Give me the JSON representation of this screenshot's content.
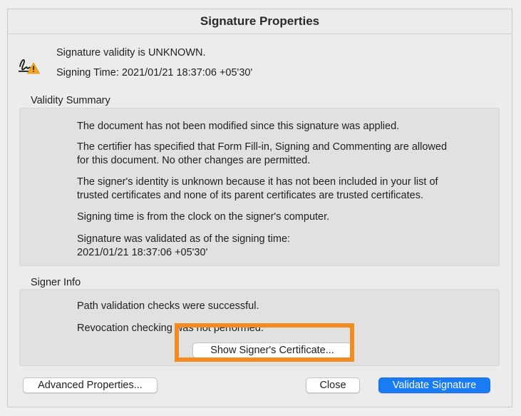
{
  "dialog": {
    "title": "Signature Properties"
  },
  "status": {
    "icon": "signature-warning-icon",
    "validity_text": "Signature validity is UNKNOWN.",
    "signing_time_text": "Signing Time:  2021/01/21 18:37:06 +05'30'"
  },
  "validity_summary": {
    "label": "Validity Summary",
    "paragraphs": [
      [
        "The document has not been modified since this signature was applied."
      ],
      [
        "The certifier has specified that Form Fill-in, Signing and Commenting are allowed",
        "for this document. No other changes are permitted."
      ],
      [
        "The signer's identity is unknown because it has not been included in your list of",
        "trusted certificates and none of its parent certificates are trusted certificates."
      ],
      [
        "Signing time is from the clock on the signer's computer."
      ],
      [
        "Signature was validated as of the signing time:",
        "2021/01/21 18:37:06 +05'30'"
      ]
    ]
  },
  "signer_info": {
    "label": "Signer Info",
    "lines": [
      "Path validation checks were successful.",
      "Revocation checking was not performed."
    ],
    "show_certificate_button": "Show Signer's Certificate..."
  },
  "footer": {
    "advanced_button": "Advanced Properties...",
    "close_button": "Close",
    "validate_button": "Validate Signature"
  },
  "colors": {
    "highlight": "#f58a1f",
    "primary_button": "#1a7cf5",
    "warning": "#f5a623"
  }
}
